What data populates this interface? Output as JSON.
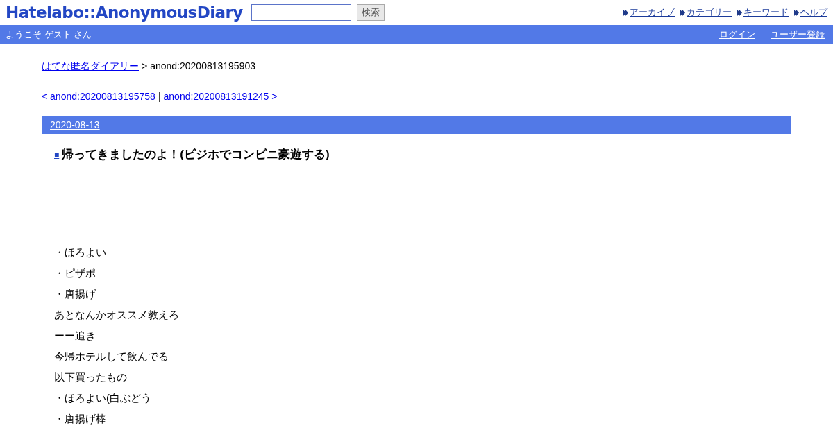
{
  "header": {
    "logo": "Hatelabo::AnonymousDiary",
    "search": {
      "button": "検索"
    },
    "links": [
      "アーカイブ",
      "カテゴリー",
      "キーワード",
      "ヘルプ"
    ]
  },
  "user_bar": {
    "welcome": "ようこそ ゲスト さん",
    "links": [
      "ログイン",
      "ユーザー登録"
    ]
  },
  "breadcrumb": {
    "link": "はてな匿名ダイアリー",
    "separator": ">",
    "current": "anond:20200813195903"
  },
  "pager": {
    "prev": "< anond:20200813195758",
    "separator": "|",
    "next": "anond:20200813191245 >"
  },
  "entry": {
    "date": "2020-08-13",
    "mark": "■",
    "title": "帰ってきましたのよ！(ビジホでコンビニ豪遊する)",
    "lines": [
      "・ほろよい",
      "・ピザポ",
      "・唐揚げ",
      "あとなんかオススメ教えろ",
      "ーー追き",
      "今帰ホテルして飲んでる",
      "以下買ったもの",
      "・ほろよい(白ぶどう",
      "・唐揚げ棒"
    ]
  }
}
